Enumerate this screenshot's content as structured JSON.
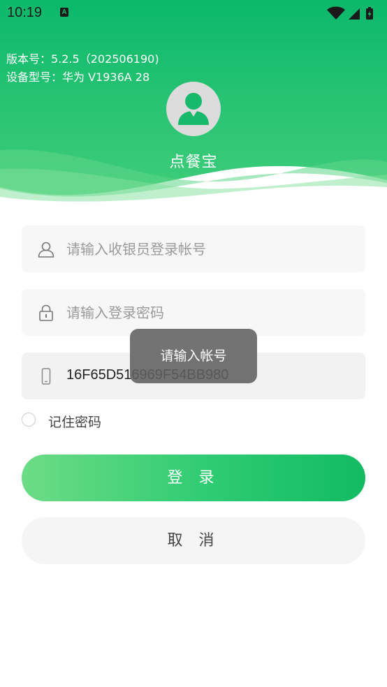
{
  "status_bar": {
    "time": "10:19",
    "notification_badge": "A",
    "icons": [
      "wifi-icon",
      "signal-icon",
      "battery-charging-icon"
    ]
  },
  "header": {
    "version_line": "版本号：5.2.5（202506190)",
    "device_model_line": "设备型号：华为 V1936A 28",
    "app_title": "点餐宝",
    "colors": {
      "gradient_top": "#0cb86b",
      "gradient_bottom": "#3fcd7a",
      "wave_light": "#6ad98a"
    }
  },
  "form": {
    "username_placeholder": "请输入收银员登录帐号",
    "username_value": "",
    "password_placeholder": "请输入登录密码",
    "password_value": "",
    "device_id": "16F65D516969F54BB980",
    "remember_label": "记住密码",
    "remember_checked": false
  },
  "buttons": {
    "login_label": "登 录",
    "cancel_label": "取 消"
  },
  "toast": {
    "message": "请输入帐号"
  },
  "colors": {
    "accent": "#12bb62",
    "accent_light": "#6ddc86"
  }
}
